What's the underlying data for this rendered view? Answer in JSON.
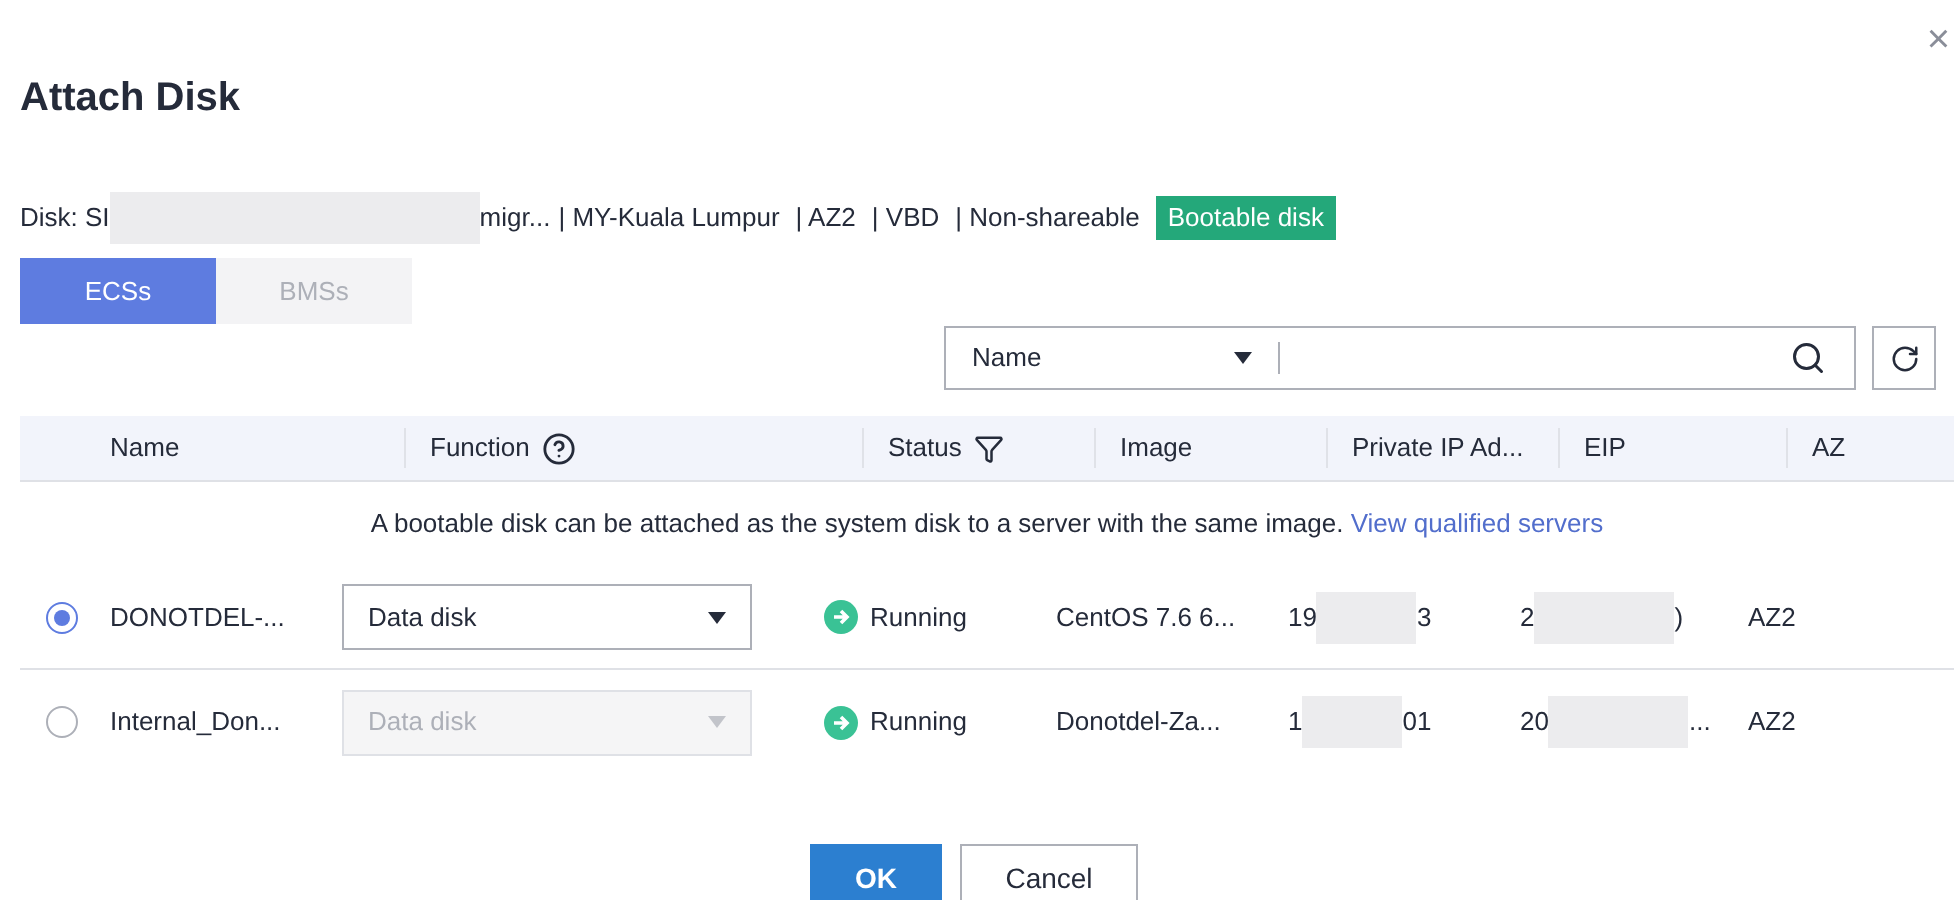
{
  "dialog": {
    "title": "Attach Disk",
    "close": "×"
  },
  "disk_info": {
    "prefix": "Disk: SI",
    "suffix": "migr...",
    "details": [
      "| MY-Kuala Lumpur",
      "| AZ2",
      "| VBD",
      "| Non-shareable"
    ],
    "badge": "Bootable disk"
  },
  "tabs": [
    {
      "label": "ECSs",
      "selected": true
    },
    {
      "label": "BMSs",
      "selected": false
    }
  ],
  "search": {
    "filter": "Name"
  },
  "table": {
    "columns": [
      "Name",
      "Function",
      "Status",
      "Image",
      "Private IP Ad...",
      "EIP",
      "AZ"
    ],
    "notice": {
      "text": "A bootable disk can be attached as the system disk to a server with the same image.",
      "link": "View qualified servers"
    },
    "rows": [
      {
        "selected": true,
        "name": "DONOTDEL-...",
        "function": "Data disk",
        "function_disabled": false,
        "status": "Running",
        "image": "CentOS 7.6 6...",
        "private_ip": [
          "19",
          "3"
        ],
        "eip": [
          "2",
          ")"
        ],
        "az": "AZ2"
      },
      {
        "selected": false,
        "name": "Internal_Don...",
        "function": "Data disk",
        "function_disabled": true,
        "status": "Running",
        "image": "Donotdel-Za...",
        "private_ip": [
          "1",
          "01"
        ],
        "eip": [
          "20",
          "..."
        ],
        "az": "AZ2"
      }
    ]
  },
  "buttons": {
    "ok": "OK",
    "cancel": "Cancel"
  }
}
